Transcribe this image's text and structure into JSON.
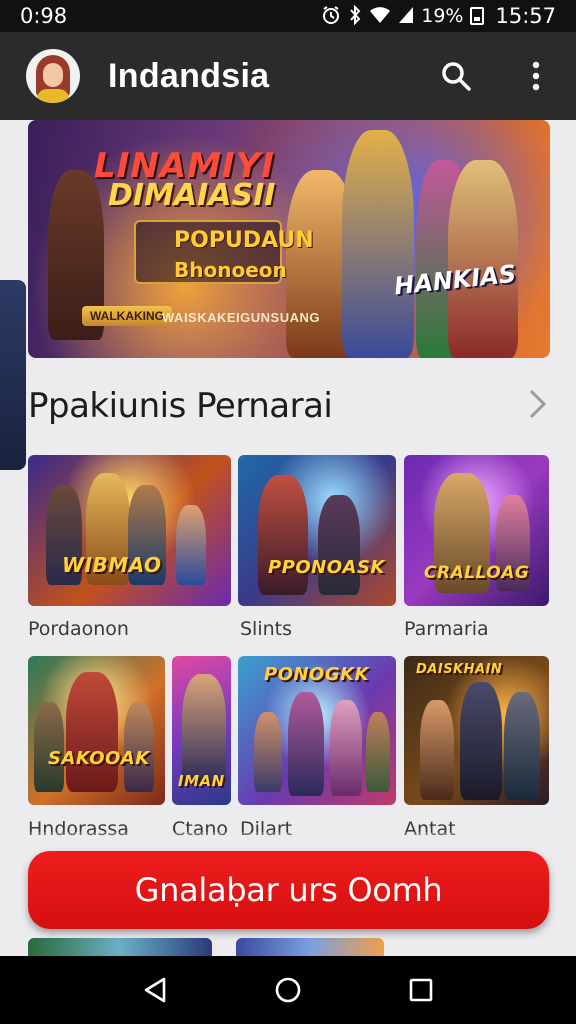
{
  "status_bar": {
    "time": "0:98",
    "battery_text": "19%",
    "clock_right": "15:57",
    "icons": [
      "alarm-icon",
      "bluetooth-icon",
      "wifi-icon",
      "signal-icon",
      "battery-icon"
    ]
  },
  "app_bar": {
    "title": "Indandsia",
    "icons": [
      "avatar",
      "search-icon",
      "more-vert-icon"
    ]
  },
  "hero": {
    "title": "LINAMIYI",
    "subtitle": "DIMAIASII",
    "line1": "POPUDAUN",
    "line2": "Bhonoeon",
    "pill": "WALKAKING",
    "caption": "WAISKAKEIGUNSUANG",
    "badge": "HANKIAS"
  },
  "section": {
    "title": "Ppakiunis Pernarai",
    "icon": "chevron-right-icon"
  },
  "games": [
    {
      "label": "Pordaonon",
      "logo": "WIBMAO"
    },
    {
      "label": "Slints",
      "logo": "PPONOASK"
    },
    {
      "label": "Parmaria",
      "logo": "CRALLOAG"
    },
    {
      "label": "Hndorassa",
      "logo": "SAKOOAK"
    },
    {
      "label": "Ctano",
      "logo": "IMAN"
    },
    {
      "label": "Dilart",
      "logo": "PONOGKK"
    },
    {
      "label": "Antat",
      "logo": "DAISKHAIN"
    }
  ],
  "cta": {
    "label": "Gnalaḅar urs Oomh"
  },
  "nav": {
    "icons": [
      "back-icon",
      "home-icon",
      "recents-icon"
    ]
  },
  "colors": {
    "app_bar": "#2b2b2b",
    "cta": "#e31616",
    "background": "#ececef"
  }
}
